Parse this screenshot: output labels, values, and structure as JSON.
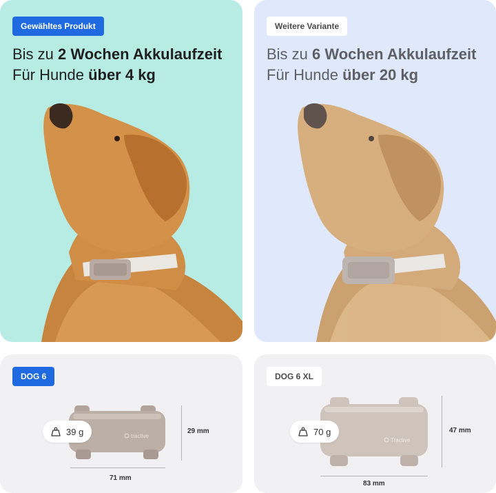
{
  "selected": {
    "badge": "Gewähltes Produkt",
    "line1_pre": "Bis zu ",
    "line1_bold": "2 Wochen Akkulaufzeit",
    "line2_pre": "Für Hunde ",
    "line2_bold": "über 4 kg",
    "bg_color": "#b6ece4"
  },
  "alternative": {
    "badge": "Weitere Variante",
    "line1_pre": "Bis zu ",
    "line1_bold": "6 Wochen Akkulaufzeit",
    "line2_pre": "Für Hunde ",
    "line2_bold": "über 20 kg",
    "bg_color": "#dfe9fb"
  },
  "dog6": {
    "badge": "DOG 6",
    "weight": "39 g",
    "height": "29 mm",
    "width": "71 mm",
    "brand": "tractive"
  },
  "dog6xl": {
    "badge": "DOG 6 XL",
    "weight": "70 g",
    "height": "47 mm",
    "width": "83 mm",
    "brand": "Tractive"
  },
  "colors": {
    "accent_blue": "#1f6ae0",
    "device_grey": "#b9aba3"
  },
  "icons": {
    "weight": "weight-icon"
  }
}
